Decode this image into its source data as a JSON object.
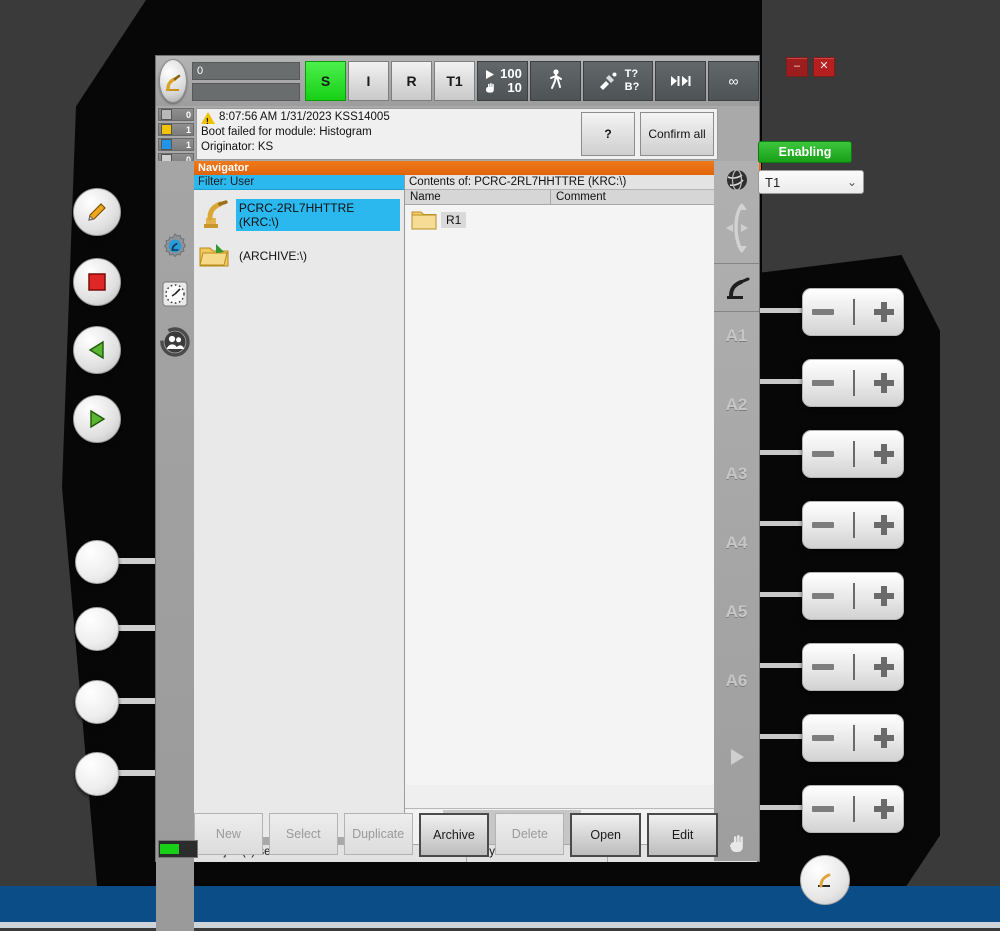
{
  "window": {
    "minimize_label": "–",
    "close_label": "✕"
  },
  "topbar": {
    "menu_icon": "kuka-robot-icon",
    "progress_value": "0",
    "progress_secondary": "",
    "status_keys": [
      {
        "name": "submit-interpreter",
        "label": "S",
        "state": "green"
      },
      {
        "name": "drives-i",
        "label": "I",
        "state": "normal"
      },
      {
        "name": "drives-r",
        "label": "R",
        "state": "normal"
      },
      {
        "name": "operating-mode",
        "label": "T1",
        "state": "normal"
      }
    ],
    "speed": {
      "program_override": "100",
      "jog_override": "10",
      "program_icon": "play-icon",
      "jog_icon": "hand-icon"
    },
    "increment_icon": "walking-man-icon",
    "tool_icon": "tool-icon",
    "tool_base": {
      "tool": "T?",
      "base": "B?"
    },
    "interpolation_icon": "skip-icon",
    "infinity_label": "∞"
  },
  "messages": {
    "counters": [
      {
        "name": "acknowledge-messages",
        "badge": "gray",
        "count": "0"
      },
      {
        "name": "state-messages",
        "badge": "yellow",
        "count": "1"
      },
      {
        "name": "notification-messages",
        "badge": "blue",
        "count": "1"
      },
      {
        "name": "wait-messages",
        "badge": "lightgray",
        "count": "0"
      }
    ],
    "icon": "warning-triangle-icon",
    "line1": "8:07:56 AM 1/31/2023 KSS14005",
    "line2": "Boot failed for module: Histogram",
    "line3": "Originator: KS",
    "help_label": "?",
    "confirm_label": "Confirm all"
  },
  "navigator": {
    "title": "Navigator",
    "filter_label": "Filter: User",
    "tree": [
      {
        "name": "tree-item-robot",
        "icon": "robot-icon",
        "label": "PCRC-2RL7HHTTRE (KRC:\\)",
        "selected": true
      },
      {
        "name": "tree-item-archive",
        "icon": "folder-archive-icon",
        "label": "(ARCHIVE:\\)",
        "selected": false
      }
    ],
    "contents_title": "Contents of: PCRC-2RL7HHTTRE (KRC:\\)",
    "columns": [
      "Name",
      "Comment"
    ],
    "files": [
      {
        "name": "file-row-r1",
        "icon": "folder-icon",
        "label": "R1",
        "comment": ""
      }
    ],
    "scroll_left": "‹",
    "scroll_right": "›"
  },
  "status_strip": {
    "selection": "1 Object(s) selected",
    "size": "0 Bytes",
    "extra": ""
  },
  "commands": [
    {
      "name": "new-button",
      "label": "New",
      "enabled": false
    },
    {
      "name": "select-button",
      "label": "Select",
      "enabled": false
    },
    {
      "name": "duplicate-button",
      "label": "Duplicate",
      "enabled": false
    },
    {
      "name": "archive-button",
      "label": "Archive",
      "enabled": true,
      "emphasis": true
    },
    {
      "name": "delete-button",
      "label": "Delete",
      "enabled": false
    },
    {
      "name": "open-button",
      "label": "Open",
      "enabled": true
    },
    {
      "name": "edit-button",
      "label": "Edit",
      "enabled": true
    }
  ],
  "left_rail": [
    {
      "name": "rail-robot-gear-icon",
      "icon": "robot-gear-icon"
    },
    {
      "name": "rail-clock-icon",
      "icon": "clock-icon"
    },
    {
      "name": "rail-user-icon",
      "icon": "user-group-icon"
    }
  ],
  "right_rail": {
    "world_icon": "globe-icon",
    "coord_icon": "bidirectional-arrows-icon",
    "robot_icon": "robot-axis-icon",
    "axis_labels": [
      "A1",
      "A2",
      "A3",
      "A4",
      "A5",
      "A6"
    ],
    "play_icon": "play-triangle-icon",
    "hand_icon": "hand-icon"
  },
  "pendant": {
    "enabling_label": "Enabling",
    "mode_value": "T1",
    "mode_caret": "⌄",
    "left_buttons": [
      {
        "name": "pendant-edit-button",
        "icon": "pencil-icon"
      },
      {
        "name": "pendant-stop-button",
        "icon": "stop-square-icon"
      },
      {
        "name": "pendant-back-button",
        "icon": "play-left-icon"
      },
      {
        "name": "pendant-start-button",
        "icon": "play-right-icon"
      }
    ],
    "round_buttons": [
      {
        "name": "pendant-round-button-1"
      },
      {
        "name": "pendant-round-button-2"
      },
      {
        "name": "pendant-round-button-3"
      },
      {
        "name": "pendant-round-button-4"
      }
    ],
    "jog_keys": [
      {
        "name": "jog-key-a1",
        "minus": "−",
        "plus": "+"
      },
      {
        "name": "jog-key-a2",
        "minus": "−",
        "plus": "+"
      },
      {
        "name": "jog-key-a3",
        "minus": "−",
        "plus": "+"
      },
      {
        "name": "jog-key-a4",
        "minus": "−",
        "plus": "+"
      },
      {
        "name": "jog-key-a5",
        "minus": "−",
        "plus": "+"
      },
      {
        "name": "jog-key-a6",
        "minus": "−",
        "plus": "+"
      },
      {
        "name": "jog-key-program-override",
        "minus": "−",
        "plus": "+"
      },
      {
        "name": "jog-key-jog-override",
        "minus": "−",
        "plus": "+"
      }
    ],
    "battery_icon": "battery-icon"
  },
  "colors": {
    "accent_orange": "#e2640c",
    "selection_blue": "#2bb8ef",
    "status_green": "#17d017",
    "taskbar_blue": "#0b4d87",
    "warning_yellow": "#f0c000"
  }
}
